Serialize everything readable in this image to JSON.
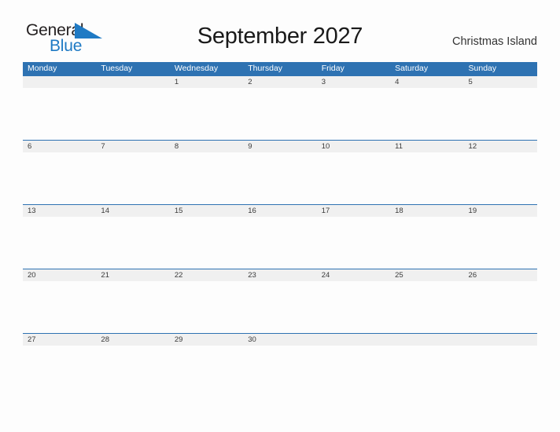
{
  "brand": {
    "line1": "General",
    "line2": "Blue",
    "flag_icon": "blue-flag-triangle",
    "color_dark": "#231f20",
    "color_blue": "#1f7ac4"
  },
  "header": {
    "title": "September 2027",
    "locale": "Christmas Island"
  },
  "theme": {
    "header_blue": "#2e72b2",
    "band_gray": "#f0f0f0",
    "page_background": "#fdfdfd",
    "date_text": "#3a3a3a"
  },
  "calendar": {
    "month": "September",
    "year": "2027",
    "weekday_headers": [
      "Monday",
      "Tuesday",
      "Wednesday",
      "Thursday",
      "Friday",
      "Saturday",
      "Sunday"
    ],
    "weeks": [
      [
        "",
        "",
        "1",
        "2",
        "3",
        "4",
        "5"
      ],
      [
        "6",
        "7",
        "8",
        "9",
        "10",
        "11",
        "12"
      ],
      [
        "13",
        "14",
        "15",
        "16",
        "17",
        "18",
        "19"
      ],
      [
        "20",
        "21",
        "22",
        "23",
        "24",
        "25",
        "26"
      ],
      [
        "27",
        "28",
        "29",
        "30",
        "",
        "",
        ""
      ]
    ]
  }
}
